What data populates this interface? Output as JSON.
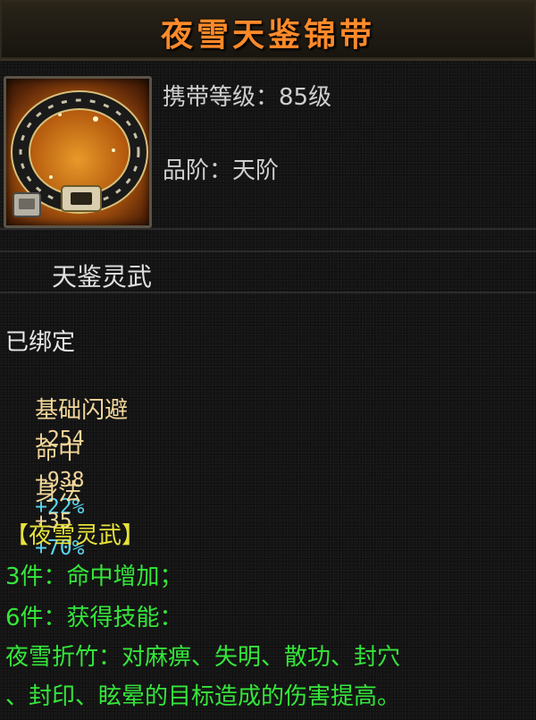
{
  "title": "夜雪天鉴锦带",
  "item": {
    "icon": "belt-icon",
    "level_label": "携带等级：",
    "level_value": "85级",
    "grade_label": "品阶：",
    "grade_value": "天阶",
    "series": "天鉴灵武"
  },
  "status": "已绑定",
  "stats": [
    {
      "name": "基础闪避",
      "value": "+254",
      "percent": ""
    },
    {
      "name": "命中",
      "value": "+938",
      "percent": "+22%"
    },
    {
      "name": "身法",
      "value": "+35",
      "percent": "+70%"
    }
  ],
  "set": {
    "name": "【夜雪灵武】",
    "bonus_3": "3件：命中增加；",
    "bonus_6": "6件：获得技能：",
    "skill_line1": "夜雪折竹：对麻痹、失明、散功、封穴",
    "skill_line2": "、封印、眩晕的目标造成的伤害提高。"
  },
  "colors": {
    "title": "#ff8a2a",
    "stat_name": "#f3d79a",
    "percent": "#5ad6f0",
    "set_name": "#e8e23a",
    "set_text": "#35e63a"
  }
}
